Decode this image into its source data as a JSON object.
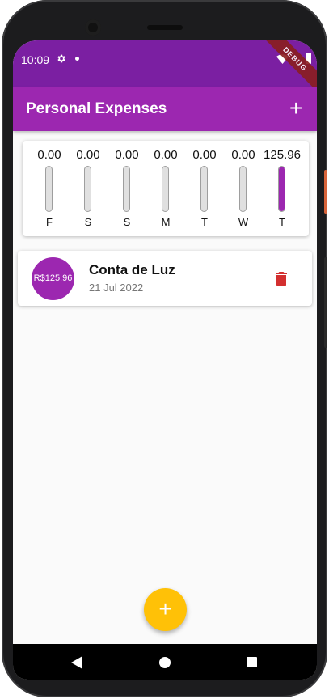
{
  "status_bar": {
    "time": "10:09",
    "debug_banner": "DEBUG"
  },
  "app_bar": {
    "title": "Personal Expenses",
    "add_icon": "+"
  },
  "chart_data": {
    "type": "bar",
    "categories": [
      "F",
      "S",
      "S",
      "M",
      "T",
      "W",
      "T"
    ],
    "values": [
      0.0,
      0.0,
      0.0,
      0.0,
      0.0,
      0.0,
      125.96
    ],
    "value_labels": [
      "0.00",
      "0.00",
      "0.00",
      "0.00",
      "0.00",
      "0.00",
      "125.96"
    ],
    "ylim": [
      0,
      125.96
    ],
    "color": "#9c27b0"
  },
  "transactions": [
    {
      "amount": "R$125.96",
      "title": "Conta de Luz",
      "date": "21 Jul 2022"
    }
  ],
  "fab": {
    "icon": "+"
  },
  "colors": {
    "primary": "#9c27b0",
    "primary_dark": "#7b1fa2",
    "accent": "#ffc107",
    "delete": "#d32f2f"
  }
}
